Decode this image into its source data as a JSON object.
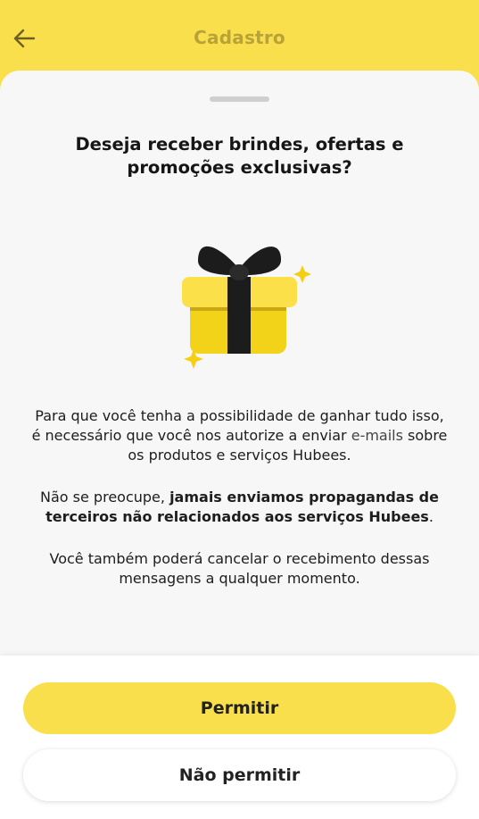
{
  "header": {
    "title": "Cadastro",
    "back_icon": "arrow-left-icon"
  },
  "sheet": {
    "question": "Deseja receber brindes, ofertas e promoções exclusivas?",
    "illustration": "gift-icon",
    "paragraph1": {
      "before": "Para que você tenha a possibilidade de ganhar tudo isso, é necessário que você nos autorize a enviar ",
      "highlight": "e-mails",
      "after": " sobre os produtos e serviços Hubees."
    },
    "paragraph2": {
      "before": "Não se preocupe, ",
      "bold": "jamais enviamos propagandas de terceiros não relacionados aos serviços Hubees",
      "after": "."
    },
    "paragraph3": "Você também poderá cancelar o recebimento dessas mensagens a qualquer momento."
  },
  "actions": {
    "allow_label": "Permitir",
    "deny_label": "Não permitir"
  },
  "colors": {
    "brand_yellow": "#f9df4b",
    "header_title": "#b8a23a",
    "sheet_bg": "#f7f7f7"
  }
}
